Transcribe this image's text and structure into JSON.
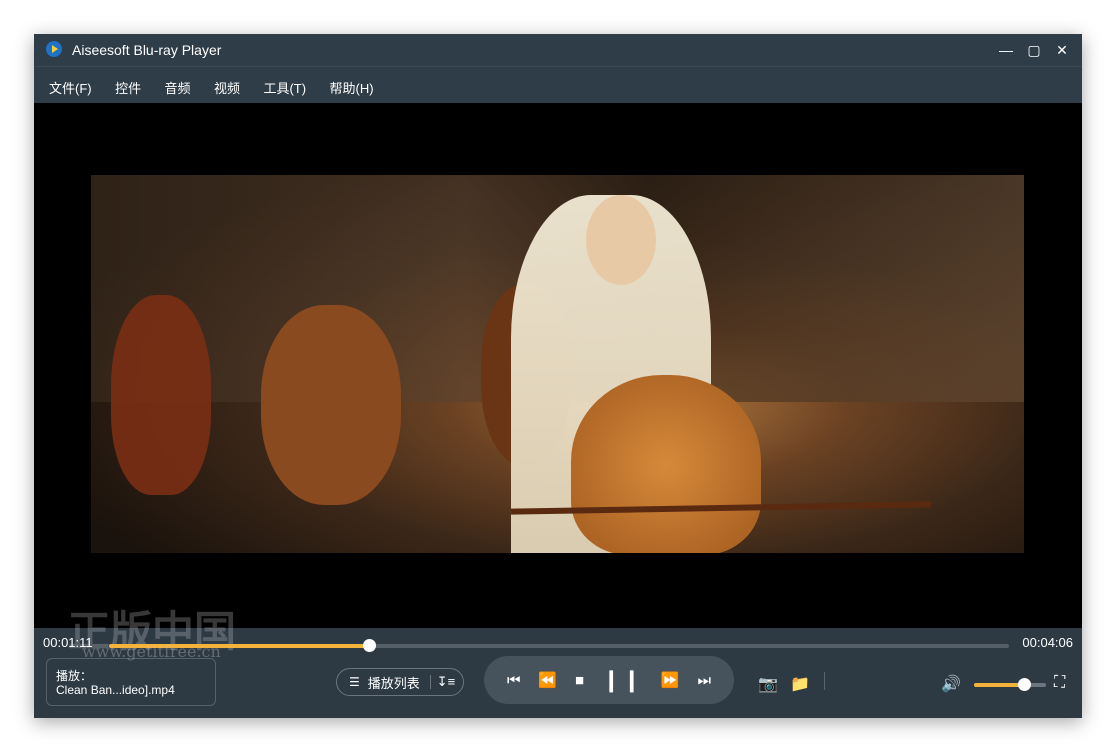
{
  "window": {
    "title": "Aiseesoft Blu-ray Player"
  },
  "menu": [
    "文件(F)",
    "控件",
    "音频",
    "视频",
    "工具(T)",
    "帮助(H)"
  ],
  "playback": {
    "current_time": "00:01:11",
    "total_time": "00:04:06",
    "progress": 0.289,
    "now_playing_label": "播放：",
    "now_playing_file": "Clean Ban...ideo].mp4",
    "playlist_label": "播放列表",
    "volume": 0.7
  },
  "watermark": {
    "text1": "正版中国",
    "text2": "www.getitfree.cn"
  },
  "icons": {
    "app": "app-logo-icon",
    "minimize": "minimize-icon",
    "maximize": "maximize-icon",
    "close": "close-icon",
    "previous": "skip-previous-icon",
    "rewind": "rewind-icon",
    "stop": "stop-icon",
    "pause": "pause-icon",
    "forward": "fast-forward-icon",
    "next": "skip-next-icon",
    "snapshot": "camera-icon",
    "open": "folder-icon",
    "volume": "speaker-icon",
    "fullscreen": "fullscreen-icon",
    "list": "list-icon",
    "sort": "sort-icon"
  },
  "colors": {
    "accent": "#f5b23b",
    "chrome": "#2f3d48"
  }
}
